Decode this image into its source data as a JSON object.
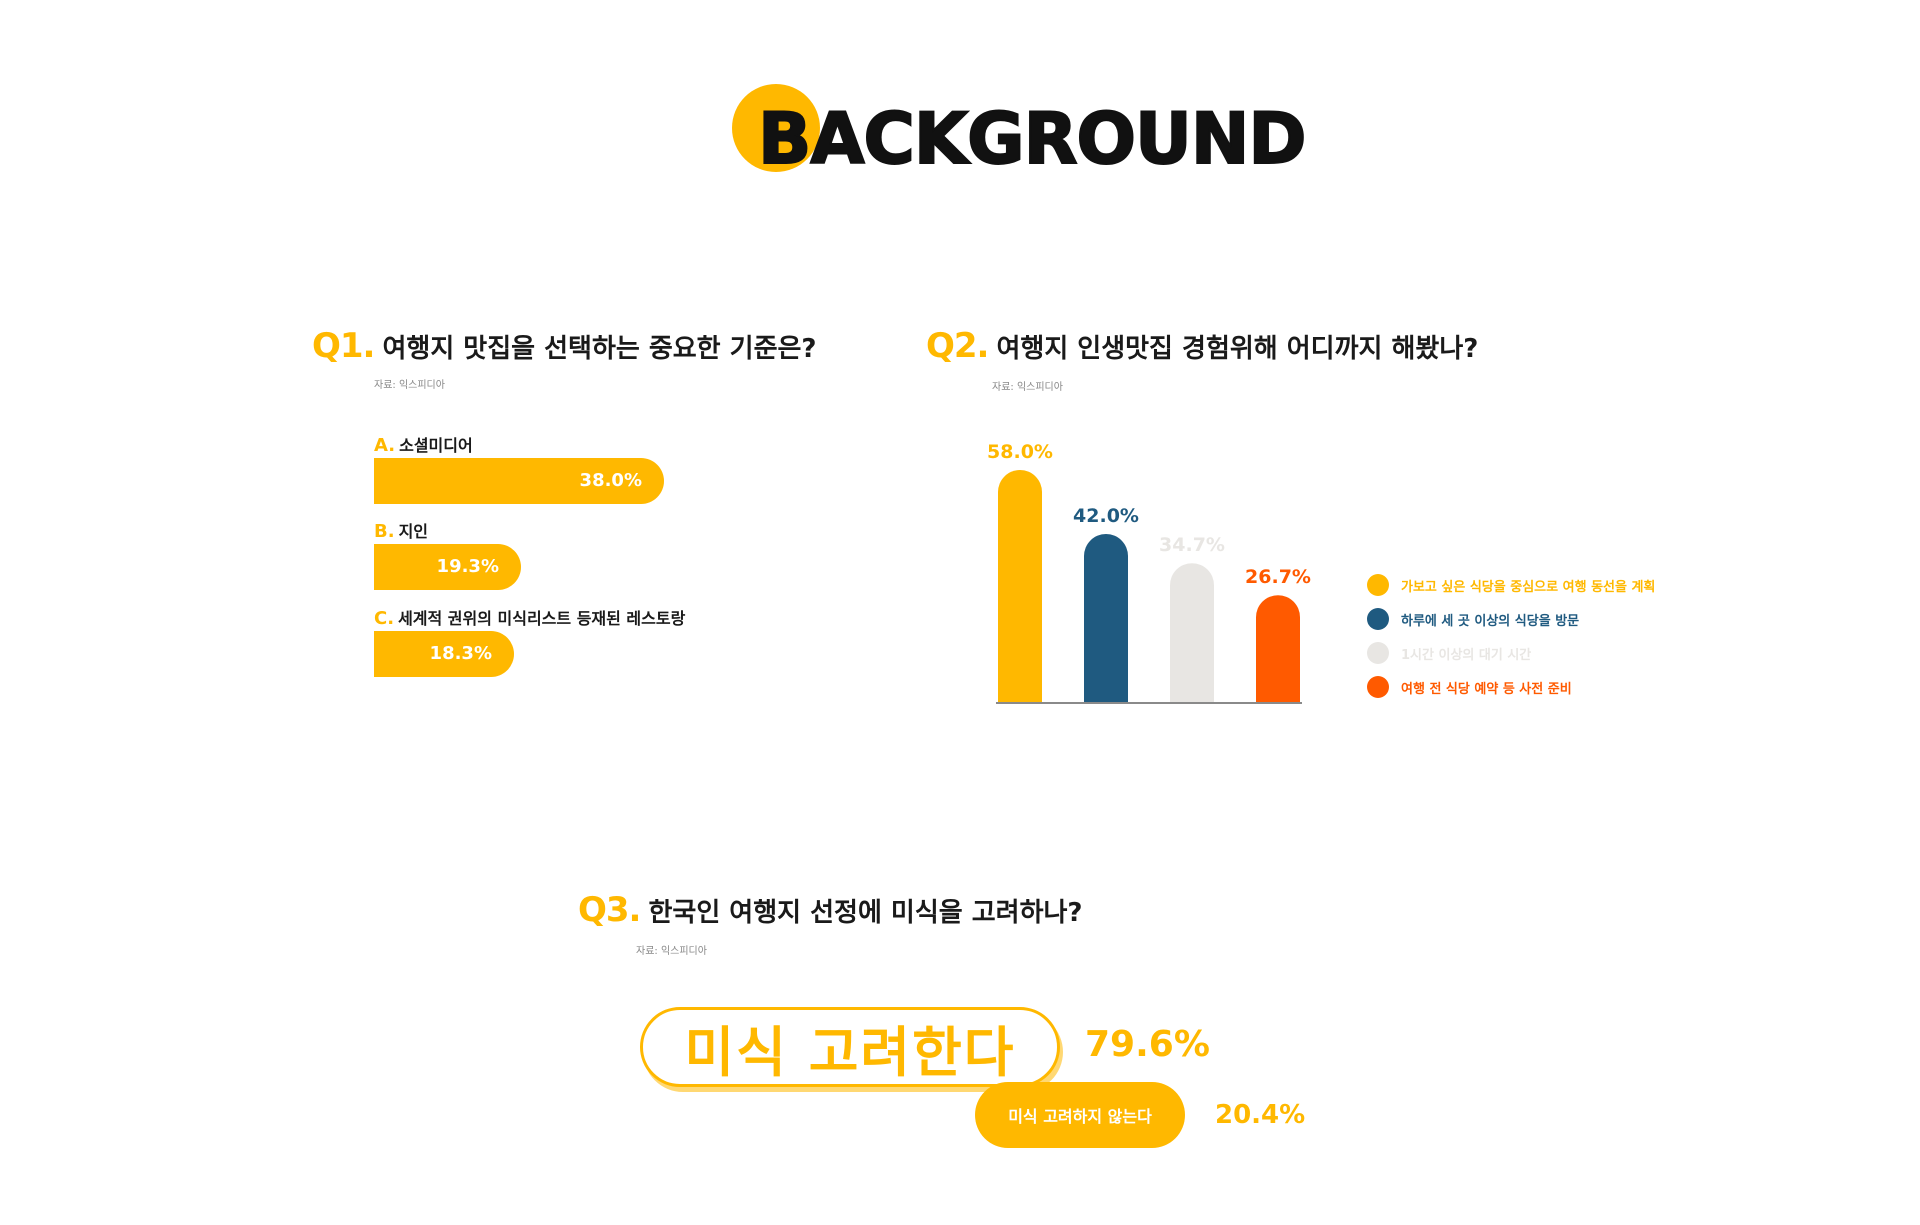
{
  "header": {
    "title": "BACKGROUND"
  },
  "colors": {
    "yellow": "#FFB800",
    "navy": "#1F5A80",
    "gray": "#E8E6E3",
    "orange": "#FF5A00",
    "text": "#1a1a1a"
  },
  "q1": {
    "number": "Q1.",
    "question": "여행지 맛집을 선택하는 중요한 기준은?",
    "source": "자료: 익스피디아",
    "items": [
      {
        "letter": "A.",
        "label": "소셜미디어",
        "value_text": "38.0%"
      },
      {
        "letter": "B.",
        "label": "지인",
        "value_text": "19.3%"
      },
      {
        "letter": "C.",
        "label": "세계적 권위의 미식리스트 등재된 레스토랑",
        "value_text": "18.3%"
      }
    ]
  },
  "q2": {
    "number": "Q2.",
    "question": "여행지 인생맛집 경험위해 어디까지 해봤나?",
    "source": "자료: 익스피디아",
    "legend": [
      {
        "label": "가보고 싶은 식당을 중심으로 여행 동선을 계획",
        "color": "#FFB800"
      },
      {
        "label": "하루에 세 곳 이상의 식당을 방문",
        "color": "#1F5A80"
      },
      {
        "label": "1시간 이상의 대기 시간",
        "color": "#E8E6E3"
      },
      {
        "label": "여행 전 식당 예약 등 사전 준비",
        "color": "#FF5A00"
      }
    ]
  },
  "q3": {
    "number": "Q3.",
    "question": "한국인 여행지 선정에 미식을 고려하나?",
    "source": "자료: 익스피디아",
    "yes_label": "미식 고려한다",
    "yes_value": "79.6%",
    "no_label": "미식 고려하지 않는다",
    "no_value": "20.4%"
  },
  "chart_data": [
    {
      "type": "bar",
      "orientation": "horizontal",
      "title": "여행지 맛집을 선택하는 중요한 기준은?",
      "categories": [
        "소셜미디어",
        "지인",
        "세계적 권위의 미식리스트 등재된 레스토랑"
      ],
      "values": [
        38.0,
        19.3,
        18.3
      ],
      "unit": "%"
    },
    {
      "type": "bar",
      "title": "여행지 인생맛집 경험위해 어디까지 해봤나?",
      "categories": [
        "가보고 싶은 식당을 중심으로 여행 동선을 계획",
        "하루에 세 곳 이상의 식당을 방문",
        "1시간 이상의 대기 시간",
        "여행 전 식당 예약 등 사전 준비"
      ],
      "values": [
        58.0,
        42.0,
        34.7,
        26.7
      ],
      "labels": [
        "58.0%",
        "42.0%",
        "34.7%",
        "26.7%"
      ],
      "colors": [
        "#FFB800",
        "#1F5A80",
        "#E8E6E3",
        "#FF5A00"
      ],
      "label_colors": [
        "#FFB800",
        "#1F5A80",
        "#E8E6E3",
        "#FF5A00"
      ],
      "legend": "right",
      "grid": false
    },
    {
      "type": "bar",
      "title": "한국인 여행지 선정에 미식을 고려하나?",
      "categories": [
        "미식 고려한다",
        "미식 고려하지 않는다"
      ],
      "values": [
        79.6,
        20.4
      ],
      "unit": "%"
    }
  ]
}
